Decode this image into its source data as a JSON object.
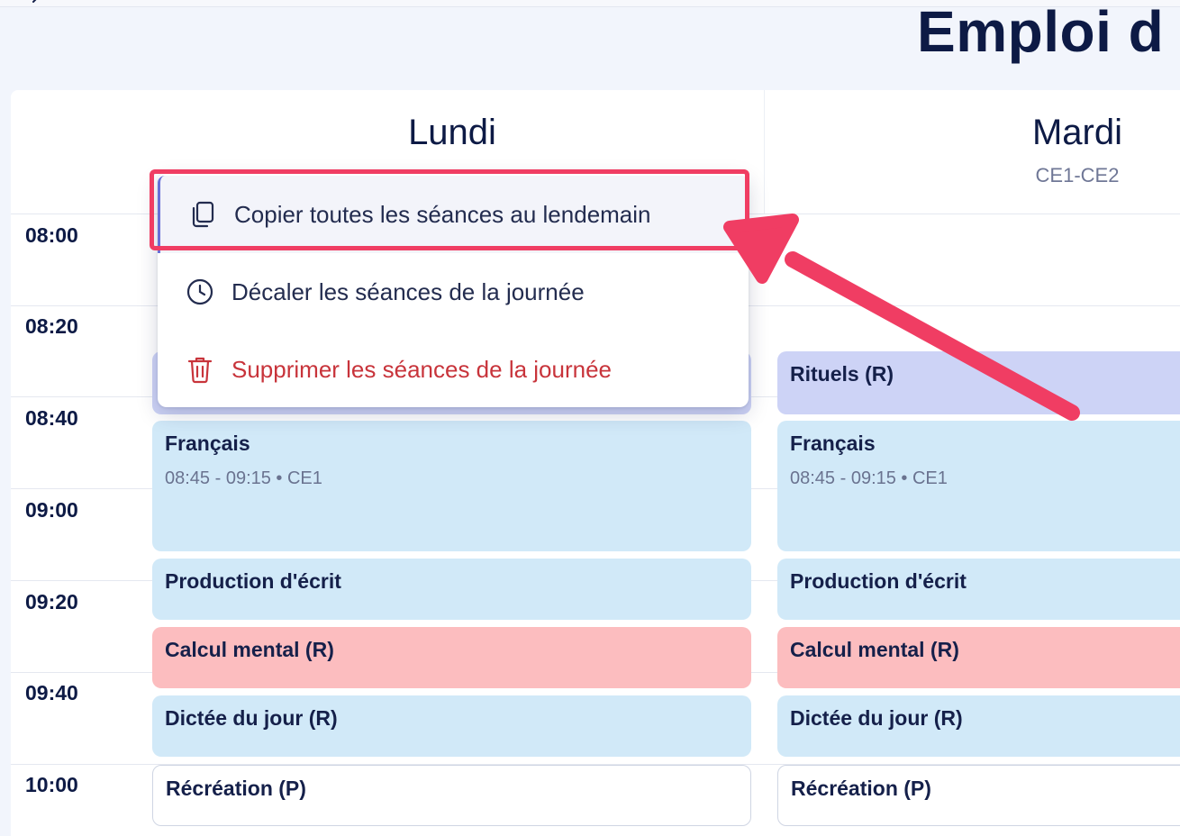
{
  "header": {
    "page_title": "Emploi d"
  },
  "days": [
    {
      "name": "Lundi",
      "class": ""
    },
    {
      "name": "Mardi",
      "class": "CE1-CE2"
    }
  ],
  "times": [
    "08:00",
    "08:20",
    "08:40",
    "09:00",
    "09:20",
    "09:40",
    "10:00"
  ],
  "context_menu": {
    "items": [
      {
        "label": "Copier toutes les séances au lendemain",
        "icon": "copy-icon"
      },
      {
        "label": "Décaler les séances de la journée",
        "icon": "clock-icon"
      },
      {
        "label": "Supprimer les séances de la journée",
        "icon": "trash-icon"
      }
    ]
  },
  "sessions": {
    "lundi": [
      {
        "title": "Français",
        "sub": "08:45 - 09:15 • CE1"
      },
      {
        "title": "Production d'écrit"
      },
      {
        "title": "Calcul mental (R)"
      },
      {
        "title": "Dictée du jour (R)"
      },
      {
        "title": "Récréation (P)"
      }
    ],
    "mardi": [
      {
        "title": "Rituels (R)"
      },
      {
        "title": "Français",
        "sub": "08:45 - 09:15 • CE1"
      },
      {
        "title": "Production d'écrit"
      },
      {
        "title": "Calcul mental (R)"
      },
      {
        "title": "Dictée du jour (R)"
      },
      {
        "title": "Récréation (P)"
      }
    ]
  },
  "colors": {
    "session_blue": "#d1e9f8",
    "session_lavender": "#cdd3f6",
    "session_pink": "#fcbdbf",
    "annotation": "#f03d63",
    "danger": "#c8343b"
  }
}
